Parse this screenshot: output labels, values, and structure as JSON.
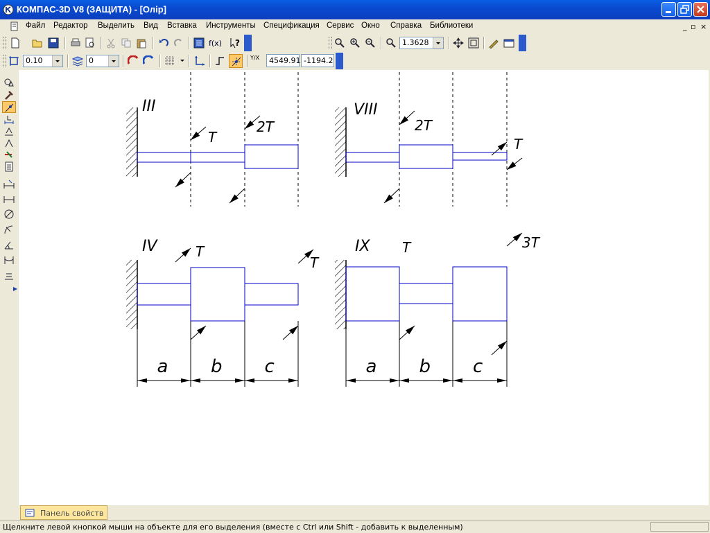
{
  "window": {
    "title": "КОМПАС-3D V8 (ЗАЩИТА) - [Олір]"
  },
  "menu": [
    "Файл",
    "Редактор",
    "Выделить",
    "Вид",
    "Вставка",
    "Инструменты",
    "Спецификация",
    "Сервис",
    "Окно",
    "Справка",
    "Библиотеки"
  ],
  "toolbar": {
    "zoom_value": "1.3628"
  },
  "params": {
    "step_value": "0.10",
    "layer_value": "0",
    "coord_x": "4549.91",
    "coord_y": "-1194.2",
    "coord_label": "Y/X"
  },
  "drawing": {
    "schemes": [
      {
        "id": "III",
        "label": "III",
        "loads": [
          "T",
          "2T"
        ]
      },
      {
        "id": "VIII",
        "label": "VIII",
        "loads": [
          "2T",
          "T"
        ]
      },
      {
        "id": "IV",
        "label": "IV",
        "loads": [
          "T",
          "T"
        ]
      },
      {
        "id": "IX",
        "label": "IX",
        "loads": [
          "T",
          "3T"
        ]
      }
    ],
    "dimensions": [
      "a",
      "b",
      "c"
    ]
  },
  "props_panel": {
    "label": "Панель свойств"
  },
  "status": {
    "message": "Щелкните левой кнопкой мыши на объекте для его выделения (вместе с Ctrl или Shift - добавить к выделенным)"
  },
  "icons": [
    "app-icon",
    "minimize-icon",
    "restore-icon",
    "close-icon",
    "new-file-icon",
    "open-icon",
    "save-icon",
    "print-icon",
    "cut-icon",
    "copy-icon",
    "paste-icon",
    "undo-icon",
    "redo-icon",
    "variables-icon",
    "function-icon",
    "help-icon",
    "zoom-icon",
    "zoom-in-icon",
    "zoom-out-icon",
    "zoom-window-icon",
    "pan-icon",
    "fit-icon",
    "properties-icon",
    "layers-icon",
    "snap-icon",
    "grid-icon",
    "ortho-icon",
    "local-cs-icon"
  ],
  "colors": {
    "title_bar": "#0a4ad0",
    "drawing_line": "#0000c8",
    "accent": "#ffc868"
  }
}
